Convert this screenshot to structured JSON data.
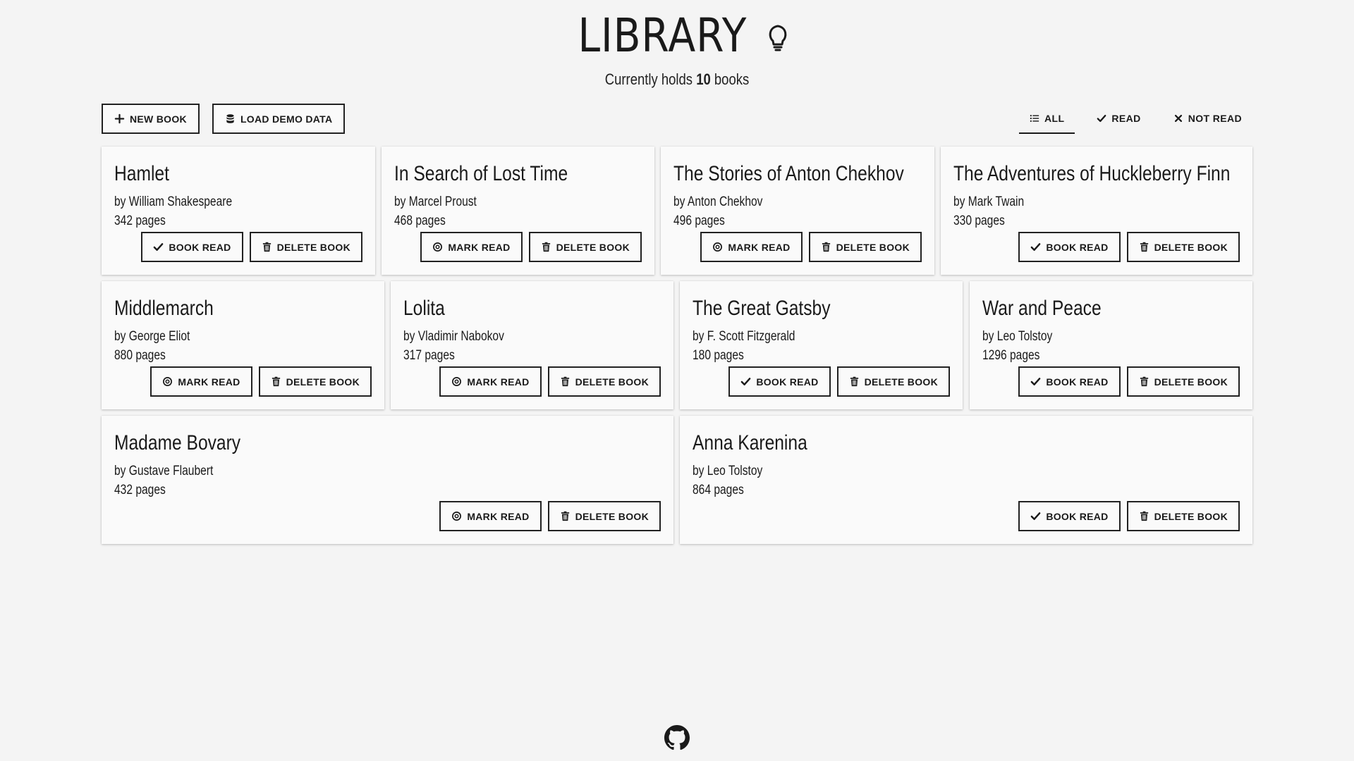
{
  "header": {
    "title": "LIBRARY",
    "icon": "lightbulb-icon",
    "subtitle_prefix": "Currently holds",
    "count": "10",
    "subtitle_suffix": "books"
  },
  "toolbar": {
    "new_book": "NEW BOOK",
    "load_demo": "LOAD DEMO DATA"
  },
  "filters": {
    "all": "ALL",
    "read": "READ",
    "not_read": "NOT READ",
    "active": "all"
  },
  "books": [
    {
      "title": "Hamlet",
      "author": "by William Shakespeare",
      "pages": "342 pages",
      "read": true
    },
    {
      "title": "In Search of Lost Time",
      "author": "by Marcel Proust",
      "pages": "468 pages",
      "read": false
    },
    {
      "title": "The Stories of Anton Chekhov",
      "author": "by Anton Chekhov",
      "pages": "496 pages",
      "read": false
    },
    {
      "title": "The Adventures of Huckleberry Finn",
      "author": "by Mark Twain",
      "pages": "330 pages",
      "read": true
    },
    {
      "title": "Middlemarch",
      "author": "by George Eliot",
      "pages": "880 pages",
      "read": false
    },
    {
      "title": "Lolita",
      "author": "by Vladimir Nabokov",
      "pages": "317 pages",
      "read": false
    },
    {
      "title": "The Great Gatsby",
      "author": "by F. Scott Fitzgerald",
      "pages": "180 pages",
      "read": true
    },
    {
      "title": "War and Peace",
      "author": "by Leo Tolstoy",
      "pages": "1296 pages",
      "read": true
    },
    {
      "title": "Madame Bovary",
      "author": "by Gustave Flaubert",
      "pages": "432 pages",
      "read": false
    },
    {
      "title": "Anna Karenina",
      "author": "by Leo Tolstoy",
      "pages": "864 pages",
      "read": true
    }
  ],
  "labels": {
    "book_read": "BOOK READ",
    "mark_read": "MARK READ",
    "delete_book": "DELETE BOOK"
  },
  "footer": {
    "icon": "github-icon"
  }
}
